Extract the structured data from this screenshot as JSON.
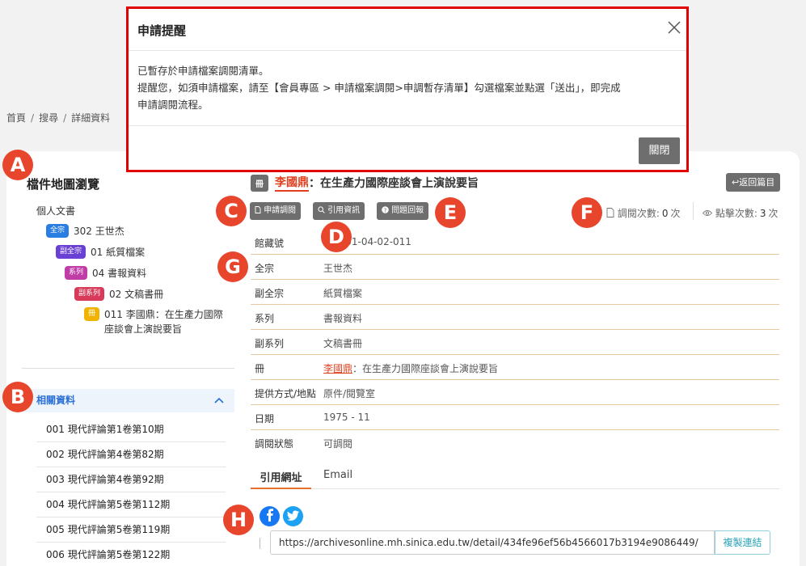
{
  "breadcrumb": [
    "首頁",
    "搜尋",
    "詳細資料"
  ],
  "left": {
    "title": "檔件地圖瀏覽",
    "tree": [
      {
        "badge": "",
        "text": "個人文書"
      },
      {
        "badge": "全宗",
        "text": "302 王世杰"
      },
      {
        "badge": "副全宗",
        "text": "01 紙質檔案"
      },
      {
        "badge": "系列",
        "text": "04 書報資料"
      },
      {
        "badge": "副系列",
        "text": "02 文稿書冊"
      },
      {
        "badge": "冊",
        "text_line1": "011 李國鼎：在生產力國際",
        "text_line2": "座談會上演說要旨"
      }
    ],
    "badge_colors": {
      "全宗": "#2a7de1",
      "副全宗": "#6a3fd4",
      "系列": "#c03da8",
      "副系列": "#d83a5a",
      "冊": "#f2b300"
    },
    "related_title": "相關資料",
    "related_items": [
      "001 現代評論第1卷第10期",
      "002 現代評論第4卷第82期",
      "003 現代評論第4卷第92期",
      "004 現代評論第5卷第112期",
      "005 現代評論第5卷第119期",
      "006 現代評論第5卷第122期"
    ]
  },
  "doc": {
    "badge": "冊",
    "title_link": "李國鼎",
    "title_rest": "：在生產力國際座談會上演說要旨",
    "back_label": "↩返回篇目",
    "actions": [
      "申請調閱",
      "引用資訊",
      "問題回報"
    ],
    "counts": {
      "apply_label": "調閱次數:",
      "apply_value": "0",
      "click_label": "點擊次數:",
      "click_value": "3",
      "unit": "次"
    },
    "fields": [
      {
        "label": "館藏號",
        "value": "302-01-04-02-011"
      },
      {
        "label": "全宗",
        "value": "王世杰"
      },
      {
        "label": "副全宗",
        "value": "紙質檔案"
      },
      {
        "label": "系列",
        "value": "書報資料"
      },
      {
        "label": "副系列",
        "value": "文稿書冊"
      },
      {
        "label": "冊",
        "value_link": "李國鼎",
        "value": "：在生產力國際座談會上演說要旨"
      },
      {
        "label": "提供方式/地點",
        "value": "原件/閱覽室"
      },
      {
        "label": "日期",
        "value": "1975 - 11"
      },
      {
        "label": "調閱狀態",
        "value": "可調閱"
      }
    ],
    "tabs": [
      "引用網址",
      "Email"
    ],
    "url": "https://archivesonline.mh.sinica.edu.tw/detail/434fe96ef56b4566017b3194e9086449/",
    "copy_label": "複製連結"
  },
  "annotations": [
    "A",
    "B",
    "C",
    "D",
    "E",
    "F",
    "G",
    "H"
  ],
  "modal": {
    "title": "申請提醒",
    "line1": "已暫存於申請檔案調閱清單。",
    "line2": "提醒您，如須申請檔案，請至【會員專區 > 申請檔案調閱>申調暫存清單】勾選檔案並點選「送出」，即完成",
    "line3": "申請調閱流程。",
    "close_label": "關閉"
  },
  "colors": {
    "accent_red": "#e8452d",
    "link_blue": "#2a6fd6",
    "tab_orange": "#e8702d",
    "facebook": "#1877f2",
    "twitter": "#1da1f2"
  }
}
